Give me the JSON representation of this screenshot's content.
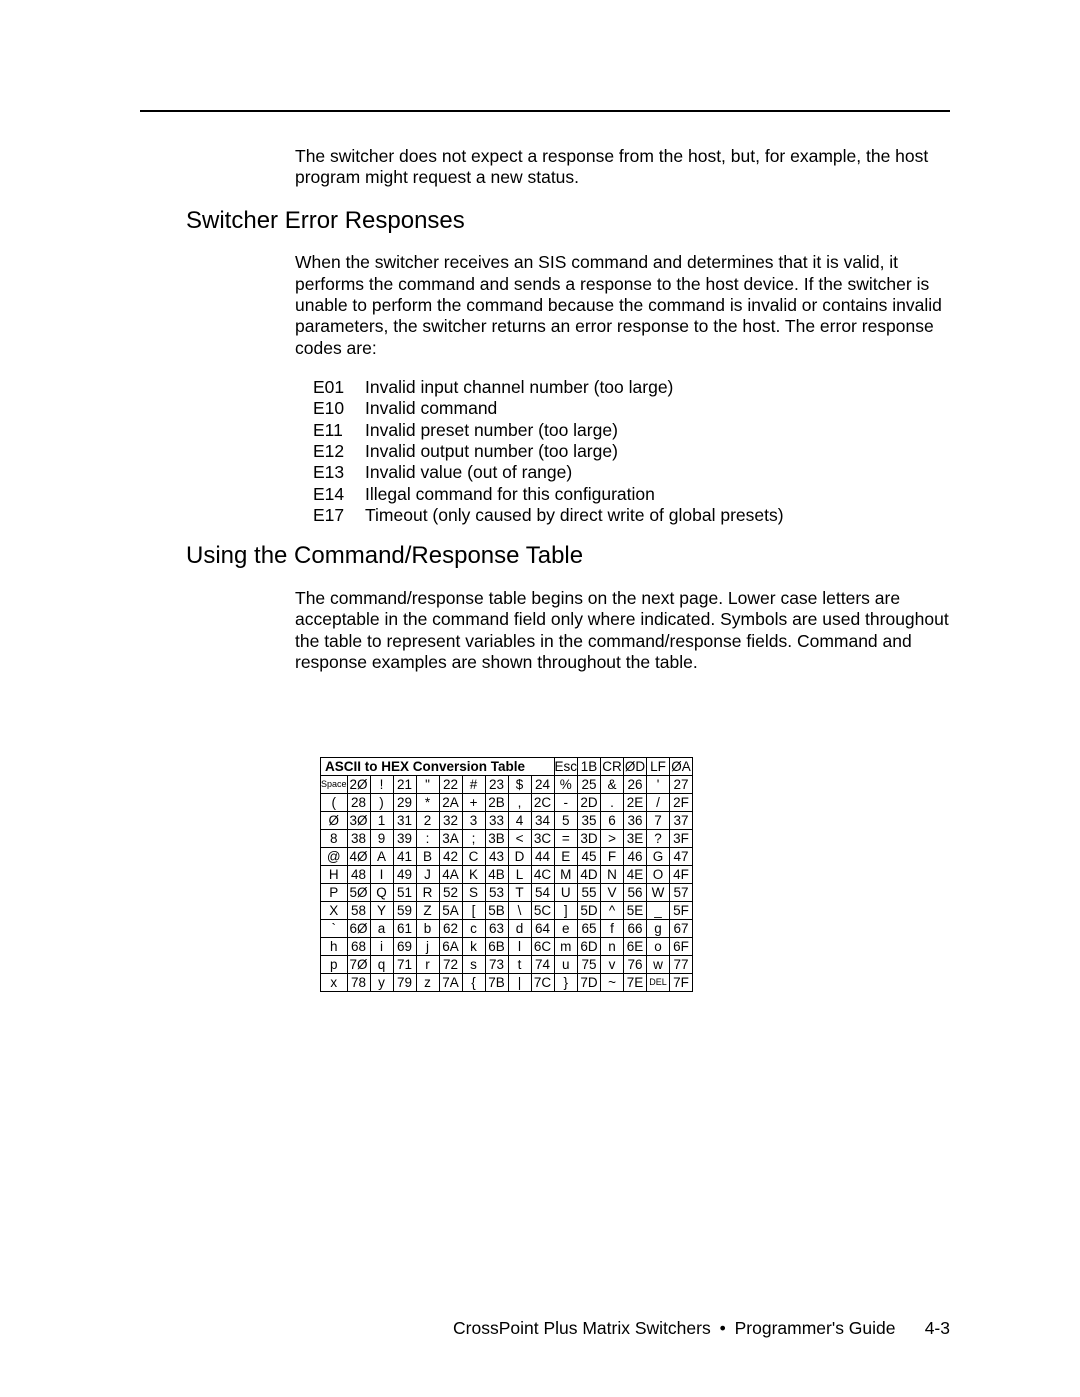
{
  "intro": "The switcher does not expect a response from the host, but, for example, the host program might request a new status.",
  "heading1": "Switcher Error Responses",
  "para1": "When the switcher receives an SIS command and determines that it is valid, it performs the command and sends a response to the host device.  If the switcher is unable to perform the command because the command is invalid or contains invalid parameters, the switcher returns an error response to the host.  The error response codes are:",
  "errors": [
    {
      "code": "E01",
      "desc": "Invalid input channel number (too large)"
    },
    {
      "code": "E10",
      "desc": "Invalid command"
    },
    {
      "code": "E11",
      "desc": "Invalid preset number (too large)"
    },
    {
      "code": "E12",
      "desc": "Invalid output number (too large)"
    },
    {
      "code": "E13",
      "desc": "Invalid value (out of range)"
    },
    {
      "code": "E14",
      "desc": "Illegal command for this configuration"
    },
    {
      "code": "E17",
      "desc": "Timeout (only caused by direct write of global presets)"
    }
  ],
  "heading2": "Using the Command/Response Table",
  "para2": "The command/response table begins on the next page.  Lower case letters are acceptable in the command field only where indicated.  Symbols are used throughout the table to represent variables in the command/response fields.  Command and response examples are shown throughout the table.",
  "ascii": {
    "title": "ASCII to HEX  Conversion Table",
    "controls": [
      {
        "label": "Esc",
        "hex": "1B"
      },
      {
        "label": "CR",
        "hex": "ØD"
      },
      {
        "label": "LF",
        "hex": "ØA"
      }
    ],
    "rows": [
      [
        [
          "Space",
          "2Ø"
        ],
        [
          "!",
          "21"
        ],
        [
          "\"",
          "22"
        ],
        [
          "#",
          "23"
        ],
        [
          "$",
          "24"
        ],
        [
          "%",
          "25"
        ],
        [
          "&",
          "26"
        ],
        [
          "'",
          "27"
        ]
      ],
      [
        [
          "(",
          "28"
        ],
        [
          ")",
          "29"
        ],
        [
          "*",
          "2A"
        ],
        [
          "+",
          "2B"
        ],
        [
          ",",
          "2C"
        ],
        [
          "-",
          "2D"
        ],
        [
          ".",
          "2E"
        ],
        [
          "/",
          "2F"
        ]
      ],
      [
        [
          "Ø",
          "3Ø"
        ],
        [
          "1",
          "31"
        ],
        [
          "2",
          "32"
        ],
        [
          "3",
          "33"
        ],
        [
          "4",
          "34"
        ],
        [
          "5",
          "35"
        ],
        [
          "6",
          "36"
        ],
        [
          "7",
          "37"
        ]
      ],
      [
        [
          "8",
          "38"
        ],
        [
          "9",
          "39"
        ],
        [
          ":",
          "3A"
        ],
        [
          ";",
          "3B"
        ],
        [
          "<",
          "3C"
        ],
        [
          "=",
          "3D"
        ],
        [
          ">",
          "3E"
        ],
        [
          "?",
          "3F"
        ]
      ],
      [
        [
          "@",
          "4Ø"
        ],
        [
          "A",
          "41"
        ],
        [
          "B",
          "42"
        ],
        [
          "C",
          "43"
        ],
        [
          "D",
          "44"
        ],
        [
          "E",
          "45"
        ],
        [
          "F",
          "46"
        ],
        [
          "G",
          "47"
        ]
      ],
      [
        [
          "H",
          "48"
        ],
        [
          "I",
          "49"
        ],
        [
          "J",
          "4A"
        ],
        [
          "K",
          "4B"
        ],
        [
          "L",
          "4C"
        ],
        [
          "M",
          "4D"
        ],
        [
          "N",
          "4E"
        ],
        [
          "O",
          "4F"
        ]
      ],
      [
        [
          "P",
          "5Ø"
        ],
        [
          "Q",
          "51"
        ],
        [
          "R",
          "52"
        ],
        [
          "S",
          "53"
        ],
        [
          "T",
          "54"
        ],
        [
          "U",
          "55"
        ],
        [
          "V",
          "56"
        ],
        [
          "W",
          "57"
        ]
      ],
      [
        [
          "X",
          "58"
        ],
        [
          "Y",
          "59"
        ],
        [
          "Z",
          "5A"
        ],
        [
          "[",
          "5B"
        ],
        [
          "\\",
          "5C"
        ],
        [
          "]",
          "5D"
        ],
        [
          "^",
          "5E"
        ],
        [
          "_",
          "5F"
        ]
      ],
      [
        [
          "`",
          "6Ø"
        ],
        [
          "a",
          "61"
        ],
        [
          "b",
          "62"
        ],
        [
          "c",
          "63"
        ],
        [
          "d",
          "64"
        ],
        [
          "e",
          "65"
        ],
        [
          "f",
          "66"
        ],
        [
          "g",
          "67"
        ]
      ],
      [
        [
          "h",
          "68"
        ],
        [
          "i",
          "69"
        ],
        [
          "j",
          "6A"
        ],
        [
          "k",
          "6B"
        ],
        [
          "l",
          "6C"
        ],
        [
          "m",
          "6D"
        ],
        [
          "n",
          "6E"
        ],
        [
          "o",
          "6F"
        ]
      ],
      [
        [
          "p",
          "7Ø"
        ],
        [
          "q",
          "71"
        ],
        [
          "r",
          "72"
        ],
        [
          "s",
          "73"
        ],
        [
          "t",
          "74"
        ],
        [
          "u",
          "75"
        ],
        [
          "v",
          "76"
        ],
        [
          "w",
          "77"
        ]
      ],
      [
        [
          "x",
          "78"
        ],
        [
          "y",
          "79"
        ],
        [
          "z",
          "7A"
        ],
        [
          "{",
          "7B"
        ],
        [
          "|",
          "7C"
        ],
        [
          "}",
          "7D"
        ],
        [
          "~",
          "7E"
        ],
        [
          "DEL",
          "7F"
        ]
      ]
    ]
  },
  "footer": {
    "left": "CrossPoint Plus Matrix Switchers",
    "right": "Programmer's Guide",
    "page": "4-3"
  }
}
